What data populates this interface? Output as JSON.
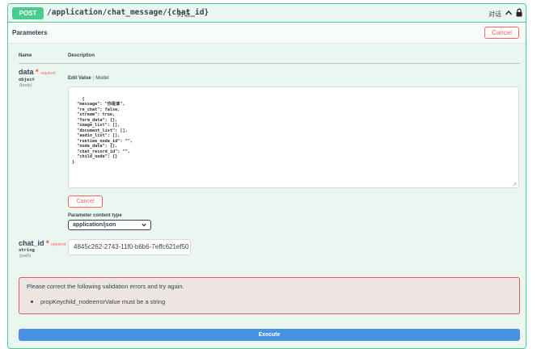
{
  "operation": {
    "method": "POST",
    "path": "/application/chat_message/{chat_id}",
    "description": "对话",
    "summary_label": "对话"
  },
  "parameters_section": {
    "title": "Parameters",
    "cancel_label": "Cancel",
    "col_name": "Name",
    "col_description": "Description"
  },
  "params": {
    "data": {
      "name": "data",
      "required_star": "*",
      "required_text": "required",
      "type": "object",
      "in": "(body)",
      "tab_edit": "Edit Value",
      "tab_sep": "|",
      "tab_model": "Model",
      "value": "{\n  \"message\": \"你是谁\",\n  \"re_chat\": false,\n  \"stream\": true,\n  \"form_data\": {},\n  \"image_list\": [],\n  \"document_list\": [],\n  \"audio_list\": [],\n  \"runtime_node_id\": \"\",\n  \"node_data\": {},\n  \"chat_record_id\": \"\",\n  \"child_node\": {}\n}",
      "cancel_label": "Cancel",
      "content_type_label": "Parameter content type",
      "content_type_value": "application/json"
    },
    "chat_id": {
      "name": "chat_id",
      "required_star": "*",
      "required_text": "required",
      "type": "string",
      "in": "(path)",
      "value": "4845c262-2743-11f0-b6b6-7effc621ef50"
    }
  },
  "validation": {
    "message": "Please correct the following validation errors and try again.",
    "errors": [
      "propKeychild_nodeerrorValue must be a string"
    ]
  },
  "execute_label": "Execute",
  "colors": {
    "post_green": "#49cc90",
    "cancel_red": "#ff6060",
    "execute_blue": "#4990e2",
    "error_bg": "#ece5e1"
  },
  "icons": {
    "collapse": "chevron-up-icon",
    "auth": "lock-icon",
    "select": "chevron-down-icon"
  }
}
